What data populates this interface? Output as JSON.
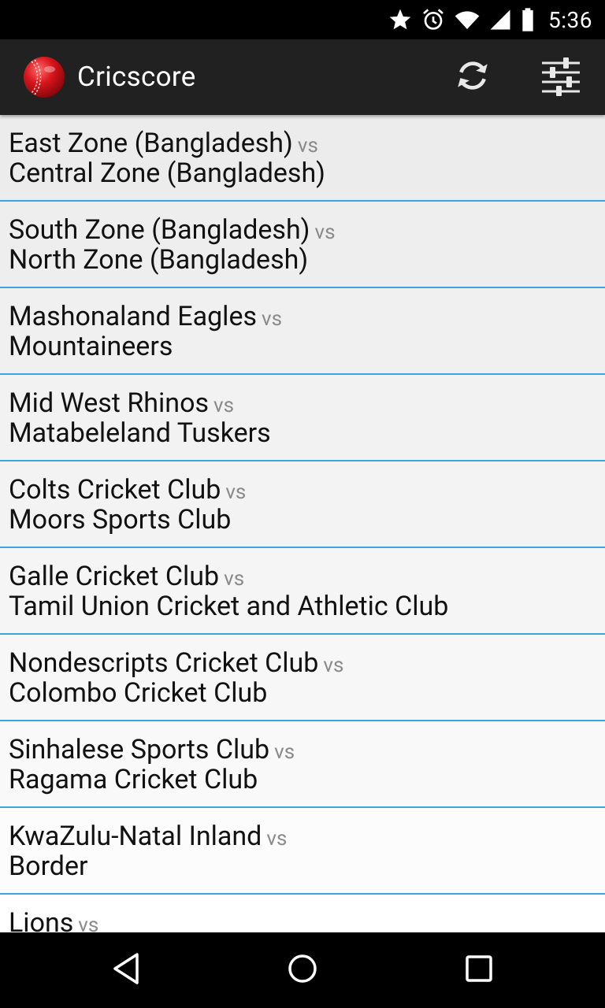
{
  "status_bar": {
    "time": "5:36",
    "icons": [
      "star-icon",
      "alarm-icon",
      "wifi-icon",
      "cell-signal-icon",
      "battery-icon"
    ]
  },
  "app_bar": {
    "title": "Cricscore",
    "actions": [
      "refresh-icon",
      "settings-sliders-icon"
    ]
  },
  "vs_label": "vs",
  "matches": [
    {
      "team1": "East Zone (Bangladesh)",
      "team2": "Central Zone (Bangladesh)",
      "bg": "#ececec"
    },
    {
      "team1": "South Zone (Bangladesh)",
      "team2": "North Zone (Bangladesh)",
      "bg": "#eeeeee"
    },
    {
      "team1": "Mashonaland Eagles",
      "team2": "Mountaineers",
      "bg": "#f0f0f0"
    },
    {
      "team1": "Mid West Rhinos",
      "team2": "Matabeleland Tuskers",
      "bg": "#f2f2f2"
    },
    {
      "team1": "Colts Cricket Club",
      "team2": "Moors Sports Club",
      "bg": "#f3f3f3"
    },
    {
      "team1": "Galle Cricket Club",
      "team2": "Tamil Union Cricket and Athletic Club",
      "bg": "#f5f5f5"
    },
    {
      "team1": "Nondescripts Cricket Club",
      "team2": "Colombo Cricket Club",
      "bg": "#f7f7f7"
    },
    {
      "team1": "Sinhalese Sports Club",
      "team2": "Ragama Cricket Club",
      "bg": "#f9f9f9"
    },
    {
      "team1": "KwaZulu-Natal Inland",
      "team2": "Border",
      "bg": "#fcfcfc"
    },
    {
      "team1": "Lions",
      "team2": "",
      "bg": "#ffffff"
    }
  ],
  "colors": {
    "divider": "#3aa6dc",
    "app_bar": "#212121",
    "vs_text": "#8a8a8a"
  },
  "nav_bar": {
    "buttons": [
      "back-icon",
      "home-icon",
      "recents-icon"
    ]
  }
}
